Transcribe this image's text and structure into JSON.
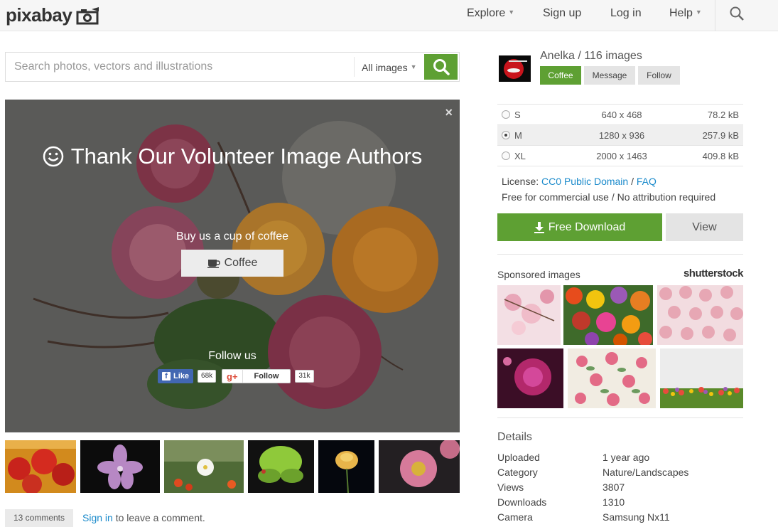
{
  "brand": {
    "name": "pixabay"
  },
  "nav": {
    "explore": "Explore",
    "signup": "Sign up",
    "login": "Log in",
    "help": "Help"
  },
  "search": {
    "placeholder": "Search photos, vectors and illustrations",
    "type": "All images"
  },
  "overlay": {
    "title": "Thank Our Volunteer Image Authors",
    "buy_text": "Buy us a cup of coffee",
    "coffee_label": "Coffee",
    "follow_text": "Follow us",
    "fb_like": "Like",
    "fb_count": "68k",
    "gp_follow": "Follow",
    "gp_count": "31k",
    "close": "×"
  },
  "author": {
    "name": "Anelka",
    "images": "116 images",
    "coffee_btn": "Coffee",
    "message_btn": "Message",
    "follow_btn": "Follow"
  },
  "sizes": [
    {
      "label": "S",
      "dims": "640 x 468",
      "size": "78.2 kB",
      "selected": false
    },
    {
      "label": "M",
      "dims": "1280 x 936",
      "size": "257.9 kB",
      "selected": true
    },
    {
      "label": "XL",
      "dims": "2000 x 1463",
      "size": "409.8 kB",
      "selected": false
    }
  ],
  "license": {
    "prefix": "License:",
    "name": "CC0 Public Domain",
    "sep": "/",
    "faq": "FAQ",
    "note": "Free for commercial use / No attribution required"
  },
  "download": {
    "label": "Free Download",
    "view": "View"
  },
  "sponsored": {
    "label": "Sponsored images",
    "provider": "shutterstock"
  },
  "comments": {
    "count": "13 comments",
    "signin": "Sign in",
    "rest": "to leave a comment."
  },
  "details": {
    "title": "Details",
    "rows": [
      {
        "label": "Uploaded",
        "value": "1 year ago"
      },
      {
        "label": "Category",
        "value": "Nature/Landscapes"
      },
      {
        "label": "Views",
        "value": "3807"
      },
      {
        "label": "Downloads",
        "value": "1310"
      },
      {
        "label": "Camera",
        "value": "Samsung Nx11"
      }
    ]
  },
  "colors": {
    "accent": "#5ea033",
    "link": "#1a8acb"
  },
  "icons": [
    "camera-logo-icon",
    "search-icon",
    "smiley-icon",
    "close-icon",
    "cup-icon",
    "facebook-icon",
    "google-plus-icon",
    "download-icon"
  ]
}
